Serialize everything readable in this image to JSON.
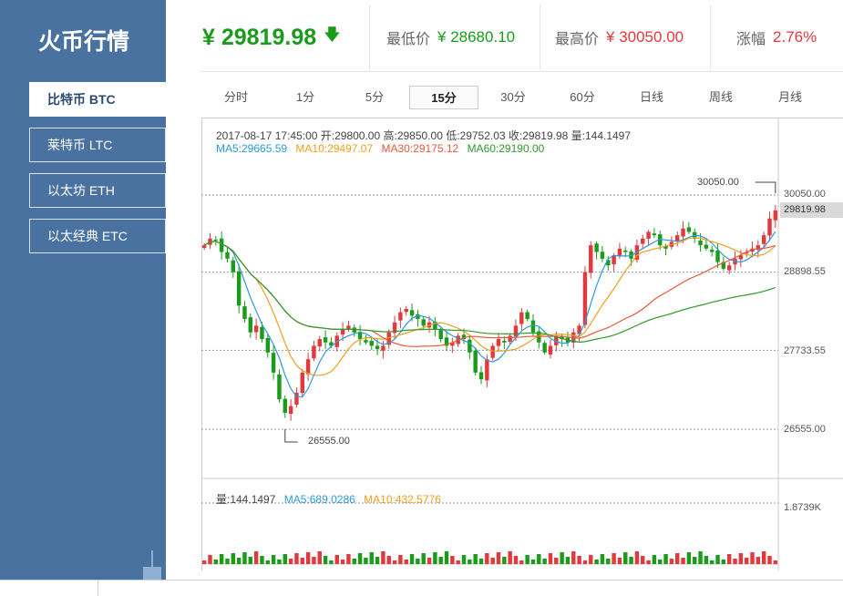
{
  "app": {
    "title": "火币行情"
  },
  "sidebar": {
    "coins": [
      {
        "label": "比特币 BTC",
        "active": true
      },
      {
        "label": "莱特币 LTC",
        "active": false
      },
      {
        "label": "以太坊 ETH",
        "active": false
      },
      {
        "label": "以太经典 ETC",
        "active": false
      }
    ]
  },
  "ticker": {
    "last_price": "¥ 29819.98",
    "direction_icon": "arrow-down-icon",
    "low_label": "最低价",
    "low_value": "¥ 28680.10",
    "high_label": "最高价",
    "high_value": "¥ 30050.00",
    "change_label": "涨幅",
    "change_value": "2.76%"
  },
  "intervals": [
    "分时",
    "1分",
    "5分",
    "15分",
    "30分",
    "60分",
    "日线",
    "周线",
    "月线"
  ],
  "active_interval": "15分",
  "info": {
    "ohlc": "2017-08-17 17:45:00  开:29800.00 高:29850.00 低:29752.03 收:29819.98 量:144.1497",
    "ma5": "MA5:29665.59",
    "ma10": "MA10:29497.07",
    "ma30": "MA30:29175.12",
    "ma60": "MA60:29190.00",
    "vol": "量:144.1497",
    "vol_ma5": "MA5:689.0286",
    "vol_ma10": "MA10:432.5776"
  },
  "axis": {
    "price_ticks": [
      "30050.00",
      "28898.55",
      "27733.55",
      "26555.00"
    ],
    "current_price_tag": "29819.98",
    "volume_max": "1.8739K"
  },
  "annotations": {
    "high": "30050.00",
    "low": "26555.00"
  },
  "colors": {
    "up": "#e0393e",
    "down": "#1a9b1a",
    "ma5": "#2d9ad8",
    "ma10": "#f0a020",
    "ma30": "#e85a3c",
    "ma60": "#2e9a2e",
    "sidebar": "#4a72a0"
  },
  "chart_data": {
    "type": "candlestick",
    "interval": "15分",
    "y_ticks": [
      30050.0,
      28898.55,
      27733.55,
      26555.0
    ],
    "high_marker": 30050.0,
    "low_marker": 26555.0,
    "last_close": 29819.98,
    "close_series": [
      29300,
      29400,
      29380,
      29200,
      29100,
      28900,
      28400,
      28200,
      28000,
      28100,
      27900,
      27700,
      27400,
      27000,
      26800,
      26900,
      27100,
      27400,
      27600,
      27800,
      27900,
      27850,
      27800,
      27950,
      28050,
      28100,
      28000,
      27900,
      27850,
      27800,
      27750,
      27800,
      28000,
      28150,
      28300,
      28350,
      28250,
      28200,
      28100,
      28150,
      28050,
      27900,
      27800,
      27850,
      27950,
      27900,
      27700,
      27400,
      27300,
      27600,
      27800,
      27900,
      27850,
      27950,
      28100,
      28300,
      28200,
      28000,
      27850,
      27700,
      27800,
      27950,
      27900,
      27850,
      28000,
      28100,
      28900,
      29300,
      29200,
      29100,
      29000,
      29150,
      29250,
      29200,
      29100,
      29300,
      29400,
      29500,
      29450,
      29300,
      29250,
      29350,
      29450,
      29550,
      29500,
      29400,
      29300,
      29250,
      29200,
      29050,
      28950,
      29000,
      29100,
      29150,
      29200,
      29250,
      29300,
      29450,
      29700,
      29820
    ],
    "volume_max_label": "1.8739K"
  }
}
